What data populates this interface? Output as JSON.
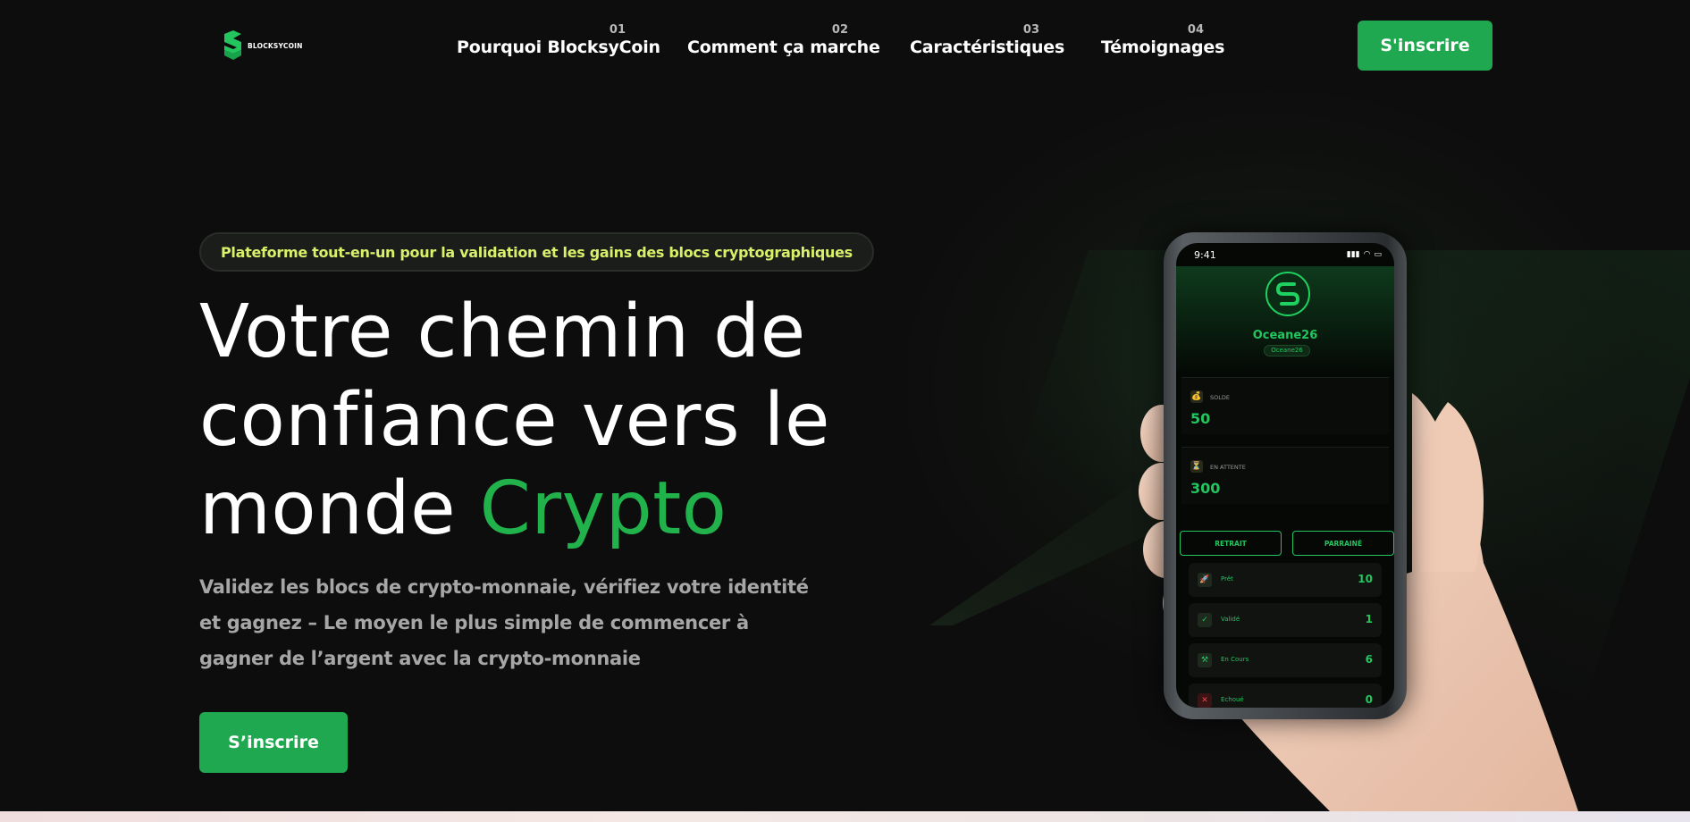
{
  "header": {
    "logo_text": "BLOCKSYCOIN",
    "nav": [
      {
        "num": "01",
        "label": "Pourquoi BlocksyCoin"
      },
      {
        "num": "02",
        "label": "Comment ça marche"
      },
      {
        "num": "03",
        "label": "Caractéristiques"
      },
      {
        "num": "04",
        "label": "Témoignages"
      }
    ],
    "cta_label": "S'inscrire"
  },
  "hero": {
    "tagline": "Plateforme tout-en-un pour la validation et les gains des blocs cryptographiques",
    "headline_line1": "Votre chemin de",
    "headline_line2": "confiance vers le",
    "headline_line3_prefix": "monde ",
    "headline_accent": "Crypto",
    "subtext": "Validez les blocs de crypto-monnaie, vérifiez votre identité et gagnez – Le moyen le plus simple de commencer à gagner de l’argent avec la crypto-monnaie",
    "cta_label": "S’inscrire"
  },
  "phone": {
    "time": "9:41",
    "username": "Oceane26",
    "user_tag": "Oceane26",
    "balance_label": "SOLDE",
    "balance_value": "50",
    "pending_label": "EN ATTENTE",
    "pending_value": "300",
    "withdraw_label": "RETRAIT",
    "referral_label": "PARRAINÉ",
    "rows": [
      {
        "label": "Prêt",
        "value": "10",
        "icon": "rocket-icon"
      },
      {
        "label": "Validé",
        "value": "1",
        "icon": "check-icon"
      },
      {
        "label": "En Cours",
        "value": "6",
        "icon": "pickaxe-icon"
      },
      {
        "label": "Echoué",
        "value": "0",
        "icon": "cross-icon"
      }
    ]
  },
  "colors": {
    "accent": "#22b24c",
    "button": "#1fa84f",
    "tagline_text": "#d8f06a",
    "background": "#0d0d0d"
  }
}
